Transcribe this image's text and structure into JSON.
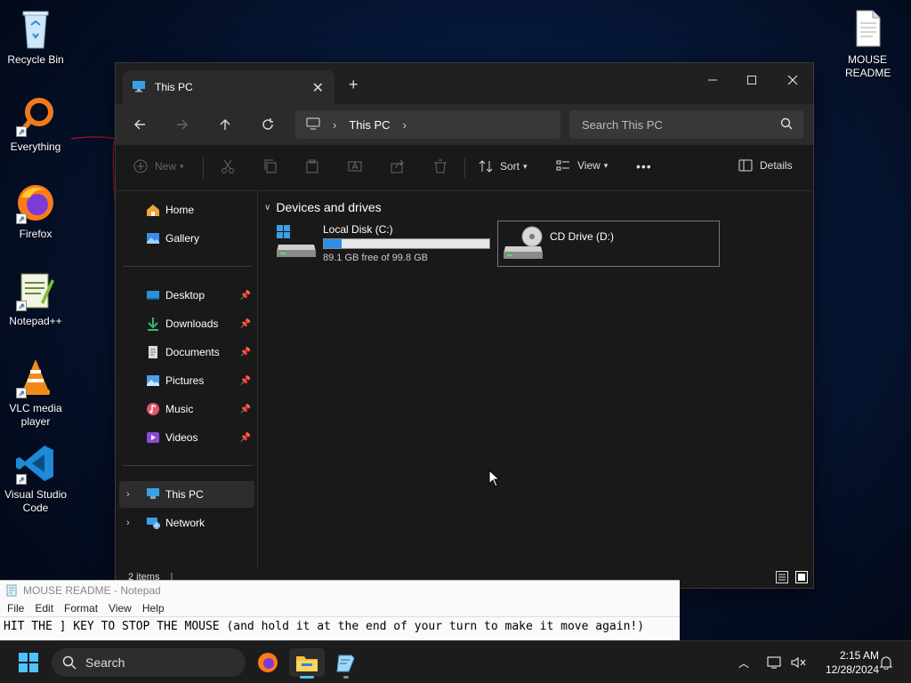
{
  "desktop": {
    "icons": [
      {
        "label": "Recycle Bin"
      },
      {
        "label": "Everything"
      },
      {
        "label": "Firefox"
      },
      {
        "label": "Notepad++"
      },
      {
        "label": "VLC media player"
      },
      {
        "label": "Visual Studio Code"
      },
      {
        "label": "MOUSE README"
      }
    ]
  },
  "explorer": {
    "tab_title": "This PC",
    "tab_close": "✕",
    "new_tab": "+",
    "breadcrumb": [
      "This PC"
    ],
    "search_placeholder": "Search This PC",
    "toolbar": {
      "new_label": "New",
      "sort_label": "Sort",
      "view_label": "View",
      "more_label": "•••",
      "details_label": "Details"
    },
    "sidebar": {
      "home": "Home",
      "gallery": "Gallery",
      "pinned": [
        "Desktop",
        "Downloads",
        "Documents",
        "Pictures",
        "Music",
        "Videos"
      ],
      "this_pc": "This PC",
      "network": "Network"
    },
    "group_header": "Devices and drives",
    "drives": [
      {
        "name": "Local Disk (C:)",
        "free_text": "89.1 GB free of 99.8 GB",
        "used_fraction": 0.107
      },
      {
        "name": "CD Drive (D:)"
      }
    ],
    "status": "2 items"
  },
  "notepad": {
    "title": "MOUSE README - Notepad",
    "menu": [
      "File",
      "Edit",
      "Format",
      "View",
      "Help"
    ],
    "text": "HIT THE ] KEY TO STOP THE MOUSE (and hold it at the end of your turn to make it move again!)"
  },
  "taskbar": {
    "search_label": "Search",
    "time": "2:15 AM",
    "date": "12/28/2024"
  },
  "colors": {
    "accent": "#2e8ee6",
    "window_bg": "#191919",
    "taskbar_bg": "#1c1c1c"
  }
}
